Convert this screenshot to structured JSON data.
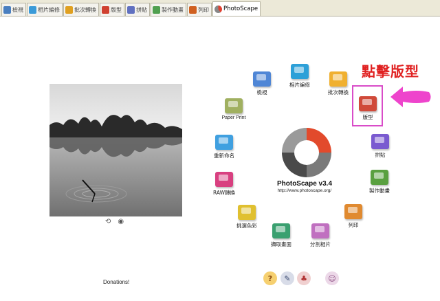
{
  "tabs": [
    {
      "label": "檢視",
      "icon": "viewer-icon",
      "color": "#4a7fc0"
    },
    {
      "label": "相片編修",
      "icon": "editor-icon",
      "color": "#3a9ad8"
    },
    {
      "label": "批次轉換",
      "icon": "batch-icon",
      "color": "#e0a020"
    },
    {
      "label": "版型",
      "icon": "page-icon",
      "color": "#d04030"
    },
    {
      "label": "拼貼",
      "icon": "combine-icon",
      "color": "#6070c0"
    },
    {
      "label": "製作動畫",
      "icon": "gif-icon",
      "color": "#50a050"
    },
    {
      "label": "列印",
      "icon": "print-icon",
      "color": "#d06020"
    },
    {
      "label": "PhotoScape",
      "icon": "photoscape-icon",
      "color": "#e04030",
      "active": true
    }
  ],
  "app": {
    "title": "PhotoScape v3.4",
    "url": "http://www.photoscape.org/"
  },
  "tools": [
    {
      "label": "檢視",
      "icon": "viewer-icon",
      "color": "#4f86d6"
    },
    {
      "label": "相片編修",
      "icon": "editor-icon",
      "color": "#2da0d8"
    },
    {
      "label": "批次轉換",
      "icon": "batch-icon",
      "color": "#f0b030"
    },
    {
      "label": "版型",
      "icon": "page-icon",
      "color": "#d04a3a"
    },
    {
      "label": "拼貼",
      "icon": "combine-icon",
      "color": "#7a5ad0"
    },
    {
      "label": "製作動畫",
      "icon": "gif-icon",
      "color": "#5aa040"
    },
    {
      "label": "列印",
      "icon": "print-icon",
      "color": "#e08a30"
    },
    {
      "label": "分割相片",
      "icon": "splitter-icon",
      "color": "#c070c0"
    },
    {
      "label": "擷取畫面",
      "icon": "screen-capture-icon",
      "color": "#3aa070"
    },
    {
      "label": "挑選色彩",
      "icon": "color-picker-icon",
      "color": "#e0c030"
    },
    {
      "label": "RAW轉換",
      "icon": "raw-converter-icon",
      "color": "#d84080"
    },
    {
      "label": "重新命名",
      "icon": "rename-icon",
      "color": "#40a0e0"
    },
    {
      "label": "Paper Print",
      "icon": "paper-print-icon",
      "color": "#a0b060"
    }
  ],
  "annotation": {
    "text": "點擊版型",
    "color": "#e02020",
    "box_color": "#d94cc8",
    "arrow_color": "#ee44cc"
  },
  "donations": "Donations!",
  "bottom_icons": [
    {
      "icon": "help-icon",
      "glyph": "?",
      "color": "#e09a20"
    },
    {
      "icon": "tools-icon",
      "glyph": "✎",
      "color": "#6a7aa0"
    },
    {
      "icon": "people-icon",
      "glyph": "♣",
      "color": "#d04040"
    },
    {
      "icon": "about-icon",
      "glyph": "☺",
      "color": "#b070a0"
    }
  ]
}
